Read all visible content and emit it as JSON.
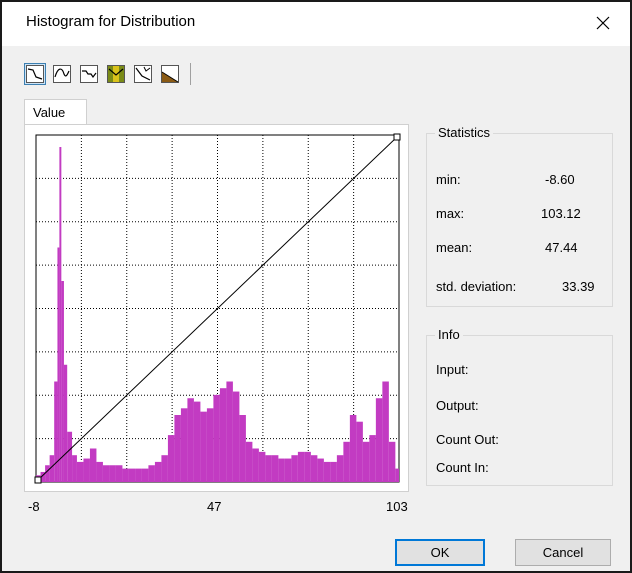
{
  "window": {
    "title": "Histogram for Distribution"
  },
  "toolbar": {
    "buttons": [
      {
        "icon": "curve-icon"
      },
      {
        "icon": "smooth-curve-icon"
      },
      {
        "icon": "step-curve-icon"
      },
      {
        "icon": "color-fill-icon"
      },
      {
        "icon": "linear-reset-icon"
      },
      {
        "icon": "scale-icon"
      }
    ]
  },
  "tab": {
    "label": "Value"
  },
  "histogram": {
    "x_labels": [
      "-8",
      "47",
      "103"
    ],
    "color": "#c23bc2",
    "grid_lines": 8
  },
  "chart_data": {
    "type": "bar",
    "xlim": [
      -8.6,
      103.12
    ],
    "x": [
      -8.6,
      -7.2,
      -5.8,
      -4.4,
      -3.0,
      -2.0,
      -1.4,
      -0.8,
      0.0,
      1.0,
      2.5,
      4.0,
      6.0,
      8.0,
      10.0,
      12.0,
      14.0,
      16.0,
      18.0,
      20.0,
      22.0,
      24.0,
      26.0,
      28.0,
      30.0,
      32.0,
      34.0,
      36.0,
      38.0,
      40.0,
      42.0,
      44.0,
      46.0,
      48.0,
      50.0,
      52.0,
      54.0,
      56.0,
      58.0,
      60.0,
      62.0,
      64.0,
      66.0,
      68.0,
      70.0,
      72.0,
      74.0,
      76.0,
      78.0,
      80.0,
      82.0,
      84.0,
      86.0,
      88.0,
      90.0,
      92.0,
      94.0,
      96.0,
      98.0,
      100.0,
      102.0
    ],
    "values": [
      2,
      3,
      5,
      8,
      30,
      70,
      100,
      60,
      35,
      15,
      8,
      6,
      7,
      10,
      6,
      5,
      5,
      5,
      4,
      4,
      4,
      4,
      5,
      6,
      8,
      14,
      20,
      22,
      25,
      24,
      21,
      22,
      26,
      28,
      30,
      27,
      20,
      12,
      10,
      9,
      8,
      8,
      7,
      7,
      8,
      9,
      9,
      8,
      7,
      6,
      6,
      8,
      12,
      20,
      18,
      12,
      14,
      25,
      30,
      12,
      4
    ]
  },
  "statistics": {
    "title": "Statistics",
    "rows": [
      {
        "label": "min:",
        "value": "-8.60"
      },
      {
        "label": "max:",
        "value": "103.12"
      },
      {
        "label": "mean:",
        "value": "47.44"
      },
      {
        "label": "std. deviation:",
        "value": "33.39"
      }
    ]
  },
  "info": {
    "title": "Info",
    "rows": [
      {
        "label": "Input:"
      },
      {
        "label": "Output:"
      },
      {
        "label": "Count Out:"
      },
      {
        "label": "Count In:"
      }
    ]
  },
  "buttons": {
    "ok": "OK",
    "cancel": "Cancel"
  }
}
